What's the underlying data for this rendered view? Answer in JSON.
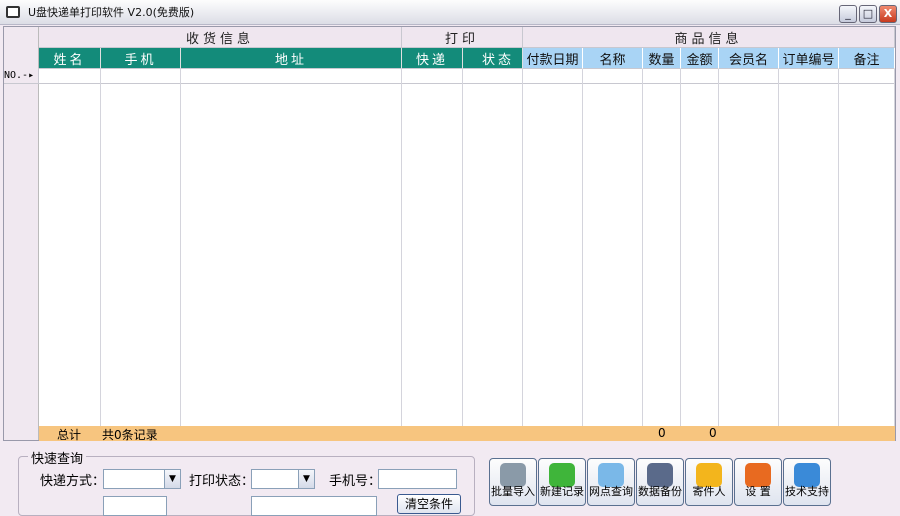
{
  "window": {
    "title": "U盘快递单打印软件 V2.0(免费版)",
    "minimize": "_",
    "maximize": "□",
    "close": "X"
  },
  "grid": {
    "groups": [
      "收货信息",
      "打印",
      "商品信息"
    ],
    "columns": [
      "姓名",
      "手机",
      "地址",
      "快递",
      "状态",
      "付款日期",
      "名称",
      "数量",
      "金额",
      "会员名",
      "订单编号",
      "备注"
    ],
    "row_indicator": "NO.-▸",
    "total": {
      "label": "总计",
      "records": "共0条记录",
      "quantity": "0",
      "amount": "0"
    }
  },
  "quick_search": {
    "legend": "快速查询",
    "courier_label": "快递方式：",
    "courier_value": "",
    "print_status_label": "打印状态：",
    "print_status_value": "",
    "phone_label": "手机号：",
    "phone_value": "",
    "clear_button": "清空条件"
  },
  "toolbar": [
    {
      "label": "批量导入",
      "icon": "database-add-icon",
      "color": "#8a9aa8"
    },
    {
      "label": "新建记录",
      "icon": "plus-icon",
      "color": "#3fb53a"
    },
    {
      "label": "网点查询",
      "icon": "magnifier-icon",
      "color": "#7ab8e8"
    },
    {
      "label": "数据备份",
      "icon": "floppy-icon",
      "color": "#5a6a8a"
    },
    {
      "label": "寄件人",
      "icon": "user-icon",
      "color": "#f3b51c"
    },
    {
      "label": "设 置",
      "icon": "wrench-icon",
      "color": "#e86a20"
    },
    {
      "label": "技术支持",
      "icon": "globe-icon",
      "color": "#3a8ad8"
    }
  ]
}
